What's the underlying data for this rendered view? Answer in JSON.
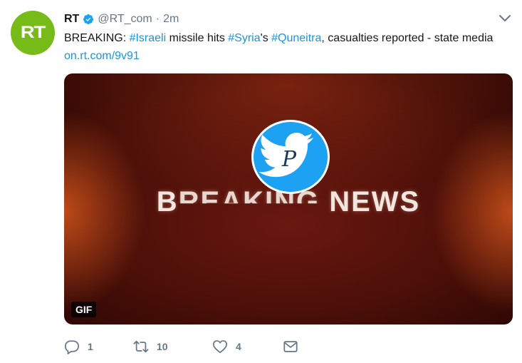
{
  "tweet": {
    "author": {
      "avatar_text": "RT",
      "avatar_color": "#76bb18",
      "name": "RT",
      "verified": true,
      "handle": "@RT_com",
      "separator": "·",
      "time": "2m"
    },
    "text": {
      "prefix": "BREAKING: ",
      "hashtag_1": "#Israeli",
      "part_2": " missile hits ",
      "hashtag_2": "#Syria",
      "part_3": "'s ",
      "hashtag_3": "#Quneitra",
      "part_4": ", casualties reported - state media ",
      "link": "on.rt.com/9v91"
    },
    "media": {
      "type": "GIF",
      "title_part_1": "B",
      "title_glitch": "REAKING",
      "title_part_2": " NEWS",
      "overlay_logo_letter": "P",
      "gif_label": "GIF"
    },
    "actions": {
      "reply_count": "1",
      "retweet_count": "10",
      "like_count": "4"
    },
    "icons": {
      "verified": "verified-badge-icon",
      "caret": "chevron-down-icon",
      "reply": "reply-icon",
      "retweet": "retweet-icon",
      "like": "heart-icon",
      "dm": "envelope-icon"
    },
    "colors": {
      "link": "#1b95e0",
      "secondary_text": "#657786",
      "twitter_blue": "#1da1f2"
    }
  }
}
